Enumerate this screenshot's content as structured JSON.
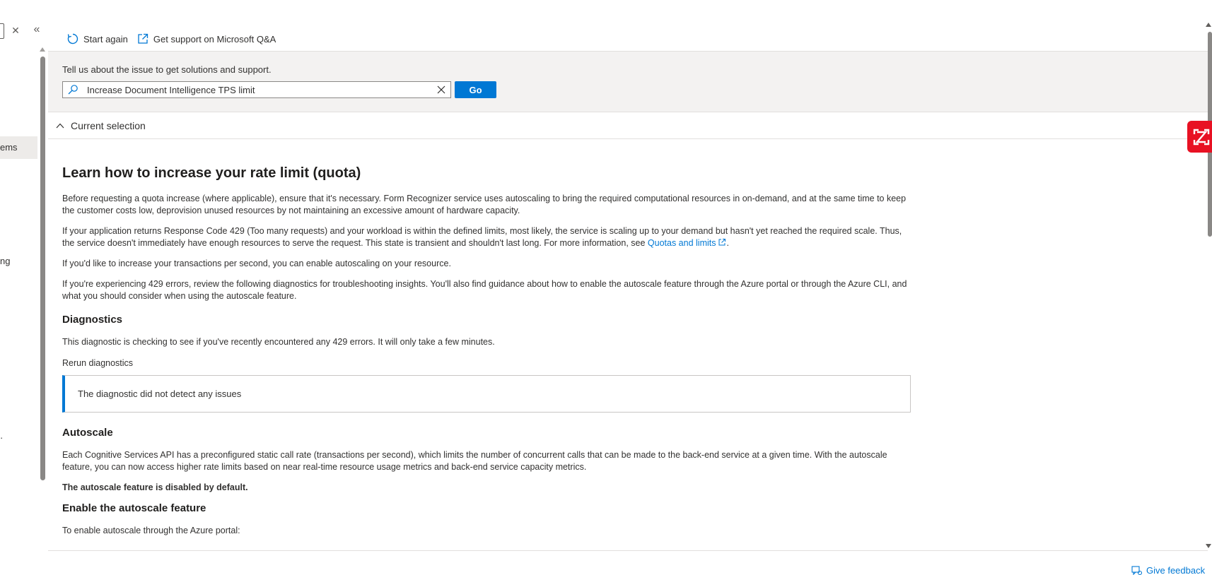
{
  "left_pane": {
    "items": [
      {
        "label": "ems",
        "top": 0
      },
      {
        "label": "ng",
        "top": 0
      },
      {
        "label": "·",
        "top": 0
      }
    ]
  },
  "toolbar": {
    "start_again_label": "Start again",
    "get_support_label": "Get support on Microsoft Q&A"
  },
  "search": {
    "prompt": "Tell us about the issue to get solutions and support.",
    "value": "Increase Document Intelligence TPS limit",
    "go_label": "Go"
  },
  "selection": {
    "label": "Current selection"
  },
  "article": {
    "title": "Learn how to increase your rate limit (quota)",
    "para1": "Before requesting a quota increase (where applicable), ensure that it's necessary. Form Recognizer service uses autoscaling to bring the required computational resources in on-demand, and at the same time to keep the customer costs low, deprovision unused resources by not maintaining an excessive amount of hardware capacity.",
    "para2_text": "If your application returns Response Code 429 (Too many requests) and your workload is within the defined limits, most likely, the service is scaling up to your demand but hasn't yet reached the required scale. Thus, the service doesn't immediately have enough resources to serve the request. This state is transient and shouldn't last long. For more information, see ",
    "para2_link": "Quotas and limits",
    "para3": "If you'd like to increase your transactions per second, you can enable autoscaling on your resource.",
    "para4": "If you're experiencing 429 errors, review the following diagnostics for troubleshooting insights. You'll also find guidance about how to enable the autoscale feature through the Azure portal or through the Azure CLI, and what you should consider when using the autoscale feature.",
    "diagnostics_heading": "Diagnostics",
    "diagnostics_text": "This diagnostic is checking to see if you've recently encountered any 429 errors. It will only take a few minutes.",
    "rerun_label": "Rerun diagnostics",
    "diagnostic_result": "The diagnostic did not detect any issues",
    "autoscale_heading": "Autoscale",
    "autoscale_text": "Each Cognitive Services API has a preconfigured static call rate (transactions per second), which limits the number of concurrent calls that can be made to the back-end service at a given time. With the autoscale feature, you can now access higher rate limits based on near real-time resource usage metrics and back-end service capacity metrics.",
    "autoscale_disabled": "The autoscale feature is disabled by default.",
    "enable_heading": "Enable the autoscale feature",
    "enable_text": "To enable autoscale through the Azure portal:"
  },
  "feedback": {
    "label": "Give feedback"
  },
  "colors": {
    "accent": "#0078d4",
    "badge": "#e81123"
  }
}
